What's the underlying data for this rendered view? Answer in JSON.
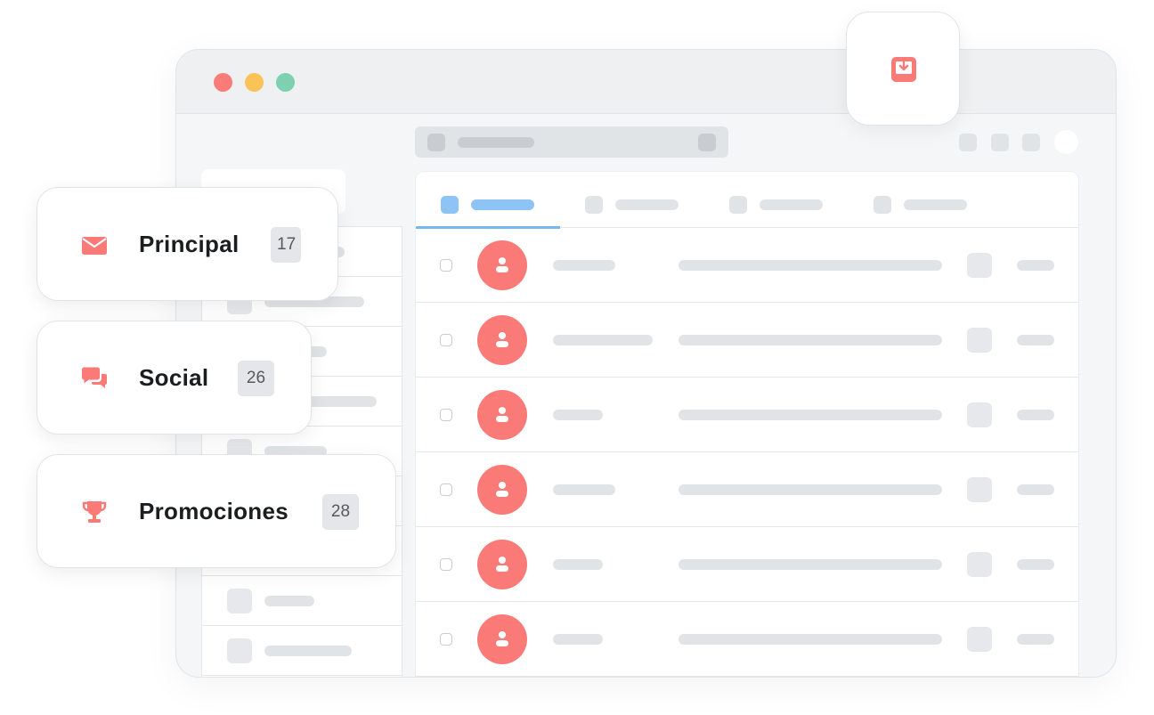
{
  "window": {
    "traffic_lights": [
      "close",
      "minimize",
      "maximize"
    ],
    "colors": {
      "close": "#fb7b78",
      "minimize": "#fbc257",
      "maximize": "#7dd1b1"
    }
  },
  "inbox_badge": {
    "icon": "inbox-download-icon",
    "color": "#f97a76"
  },
  "categories": [
    {
      "label": "Principal",
      "count": "17",
      "icon": "envelope-icon"
    },
    {
      "label": "Social",
      "count": "26",
      "icon": "chat-bubbles-icon"
    },
    {
      "label": "Promociones",
      "count": "28",
      "icon": "trophy-icon"
    }
  ],
  "tabs": {
    "active_index": 0,
    "accent": "#8ec3f6"
  },
  "accent_color": "#f97a76"
}
